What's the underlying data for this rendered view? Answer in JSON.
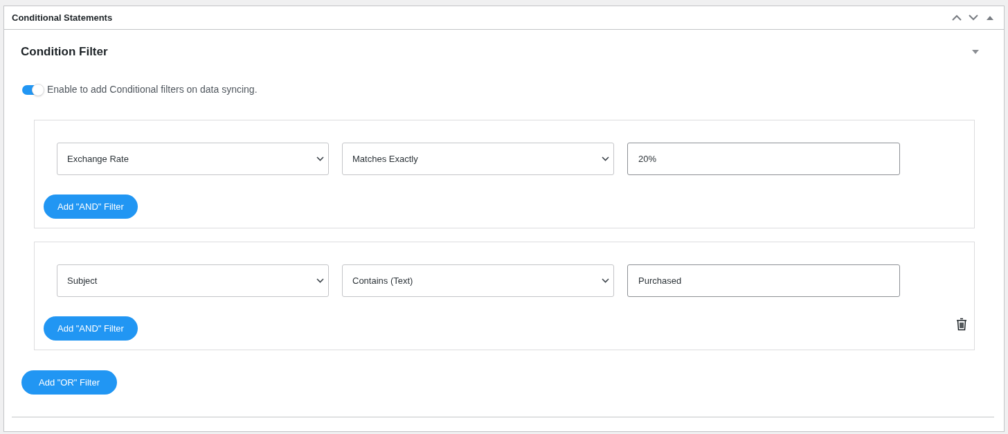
{
  "panel": {
    "title": "Conditional Statements"
  },
  "section": {
    "title": "Condition Filter",
    "expanded": true
  },
  "toggle": {
    "on": true,
    "label": "Enable to add Conditional filters on data syncing."
  },
  "groups": [
    {
      "field": "Exchange Rate",
      "operator": "Matches Exactly",
      "value": "20%",
      "add_and_label": "Add \"AND\" Filter",
      "deletable": false
    },
    {
      "field": "Subject",
      "operator": "Contains (Text)",
      "value": "Purchased",
      "add_and_label": "Add \"AND\" Filter",
      "deletable": true
    }
  ],
  "add_or_label": "Add \"OR\" Filter"
}
